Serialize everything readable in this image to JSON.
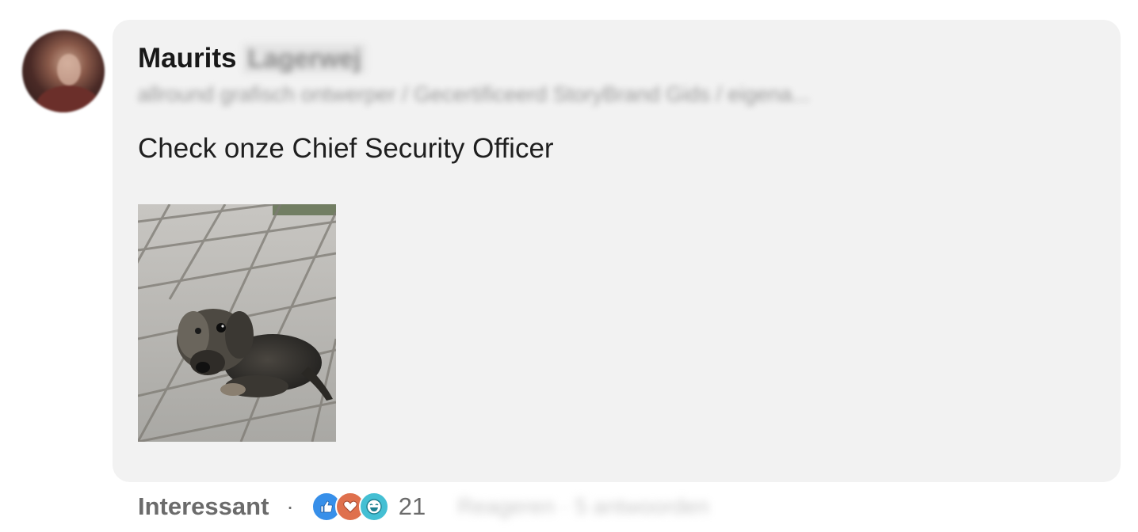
{
  "comment": {
    "author_first_name": "Maurits",
    "author_last_name_obscured": "Lagerwej",
    "headline_obscured": "allround grafisch ontwerper / Gecertificeerd StoryBrand Gids / eigena...",
    "text": "Check onze Chief Security Officer"
  },
  "footer": {
    "reaction_label": "Interessant",
    "separator": "·",
    "reaction_count": "21",
    "reply_obscured": "Reageren · 5 antwoorden"
  },
  "colors": {
    "bubble_bg": "#f2f2f2",
    "like": "#378fe9",
    "love": "#df704d",
    "funny": "#44bfd3"
  },
  "icons": [
    "like-reaction-icon",
    "love-reaction-icon",
    "funny-reaction-icon"
  ]
}
